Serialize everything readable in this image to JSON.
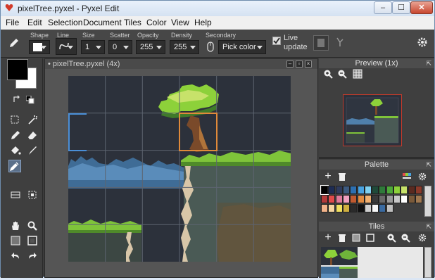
{
  "window": {
    "title": "pixelTree.pyxel - Pyxel Edit",
    "min_glyph": "–",
    "max_glyph": "☐",
    "close_glyph": "✕"
  },
  "menu": [
    "File",
    "Edit",
    "Selection",
    "Document",
    "Tiles",
    "Color",
    "View",
    "Help"
  ],
  "toolbar": {
    "shape_label": "Shape",
    "line_label": "Line",
    "size_label": "Size",
    "size_value": "1",
    "scatter_label": "Scatter",
    "scatter_value": "0",
    "opacity_label": "Opacity",
    "opacity_value": "255",
    "density_label": "Density",
    "density_value": "255",
    "secondary_label": "Secondary",
    "secondary_value": "Pick color",
    "live_update_line1": "Live",
    "live_update_line2": "update",
    "live_update_checked": true
  },
  "document": {
    "tab_title": "• pixelTree.pyxel   (4x)",
    "zoom": "4x"
  },
  "panels": {
    "preview_title": "Preview (1x)",
    "palette_title": "Palette",
    "tiles_title": "Tiles"
  },
  "palette": {
    "row1": [
      "#000000",
      "#1d2b53",
      "#2e3a5c",
      "#3d5a7f",
      "#2d6fb0",
      "#49a2e0",
      "#7fd0f0",
      "#1f4a3a",
      "#2f7a3a",
      "#4ea83a",
      "#8dd13a",
      "#c7e26a",
      "#5a2a20",
      "#8b3a2a"
    ],
    "row2": [
      "#b23a3a",
      "#e04a4a",
      "#e07a9a",
      "#f0a0c0",
      "#c05a30",
      "#e08a40",
      "#f0b070",
      "#3a3a3a",
      "#6a6a6a",
      "#9a9a9a",
      "#c8c8c8",
      "#ffffff",
      "#7a5a3a",
      "#a07850"
    ],
    "row3": [
      "#f2b38a",
      "#f5d5a0",
      "#f0e060",
      "#d0b040",
      "#2a2a2a",
      "#101010",
      "#d0d0d0",
      "#f8f8f8",
      "#3a6aa0",
      "#bfbfbf"
    ]
  },
  "colors": {
    "primary": "#000000",
    "secondary": "#ffffff",
    "sky": "#2c313b",
    "grass": "#7fc43a",
    "cliff": "#4a5a55",
    "selection": "#e08a3a",
    "marquee": "#4a8fd8"
  }
}
